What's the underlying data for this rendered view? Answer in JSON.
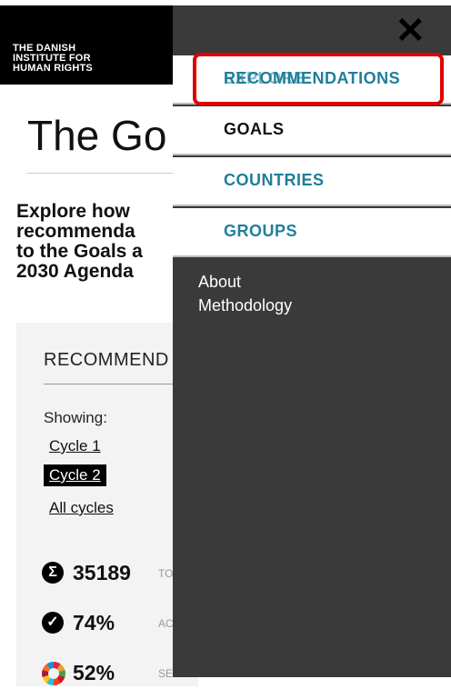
{
  "logo": {
    "text": "THE DANISH\nINSTITUTE FOR\nHUMAN RIGHTS"
  },
  "page": {
    "title": "The Go",
    "intro": "Explore how\nrecommenda\nto the Goals a\n2030 Agenda"
  },
  "panel": {
    "title": "RECOMMEND",
    "showing_label": "Showing:",
    "cycles": [
      "Cycle 1",
      "Cycle 2",
      "All cycles"
    ],
    "selected_cycle": "Cycle 2"
  },
  "stats": [
    {
      "icon": "sigma-icon",
      "glyph": "Σ",
      "value": "35189",
      "label": "TO"
    },
    {
      "icon": "check-icon",
      "glyph": "✓",
      "value": "74%",
      "label": "AC"
    },
    {
      "icon": "sdg-wheel-icon",
      "glyph": "",
      "value": "52%",
      "label": "SE"
    }
  ],
  "menu": {
    "close_glyph": "✕",
    "items": [
      {
        "label": "RECOMMENDATIONS",
        "ghost": "EXPLORE"
      },
      {
        "label": "GOALS"
      },
      {
        "label": "COUNTRIES"
      },
      {
        "label": "GROUPS"
      }
    ],
    "links": [
      "About",
      "Methodology"
    ]
  },
  "colors": {
    "accent": "#1f7f9a",
    "highlight": "#e00000",
    "menu_bg": "#3a3a3a"
  }
}
